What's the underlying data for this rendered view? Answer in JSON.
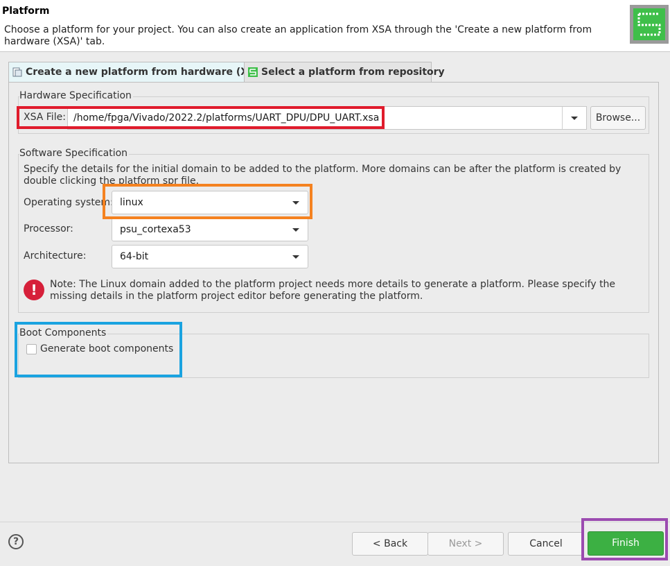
{
  "header": {
    "title": "Platform",
    "description": "Choose a platform for your project. You can also create an application from XSA through the 'Create a new platform from hardware (XSA)' tab.",
    "logo_icon": "platform-wizard-icon"
  },
  "tabs": [
    {
      "label": "Create a new platform from hardware (XSA)",
      "icon": "hardware-icon",
      "active": true
    },
    {
      "label": "Select a platform from repository",
      "icon": "repository-icon",
      "active": false
    }
  ],
  "hardware_spec": {
    "title": "Hardware Specification",
    "xsa_label": "XSA File:",
    "xsa_value": "/home/fpga/Vivado/2022.2/platforms/UART_DPU/DPU_UART.xsa",
    "browse_label": "Browse..."
  },
  "software_spec": {
    "title": "Software Specification",
    "description": "Specify the details for the initial domain to be added to the platform. More domains can be after the platform is created by double clicking the platform spr file.",
    "os_label": "Operating system:",
    "os_value": "linux",
    "processor_label": "Processor:",
    "processor_value": "psu_cortexa53",
    "arch_label": "Architecture:",
    "arch_value": "64-bit",
    "note_icon_glyph": "!",
    "note": "Note: The Linux domain added to the platform project needs more details to generate a platform. Please specify the missing details in the platform project editor before generating the platform."
  },
  "boot": {
    "title": "Boot Components",
    "checkbox_label": "Generate boot components",
    "checked": false
  },
  "footer": {
    "help_glyph": "?",
    "back_label": "< Back",
    "next_label": "Next >",
    "cancel_label": "Cancel",
    "finish_label": "Finish"
  },
  "colors": {
    "highlight_red": "#e01b2c",
    "highlight_orange": "#f58220",
    "highlight_blue": "#1aa3e0",
    "highlight_purple": "#9b4bb0",
    "finish_green": "#3cb043",
    "error_red": "#d6203a"
  }
}
